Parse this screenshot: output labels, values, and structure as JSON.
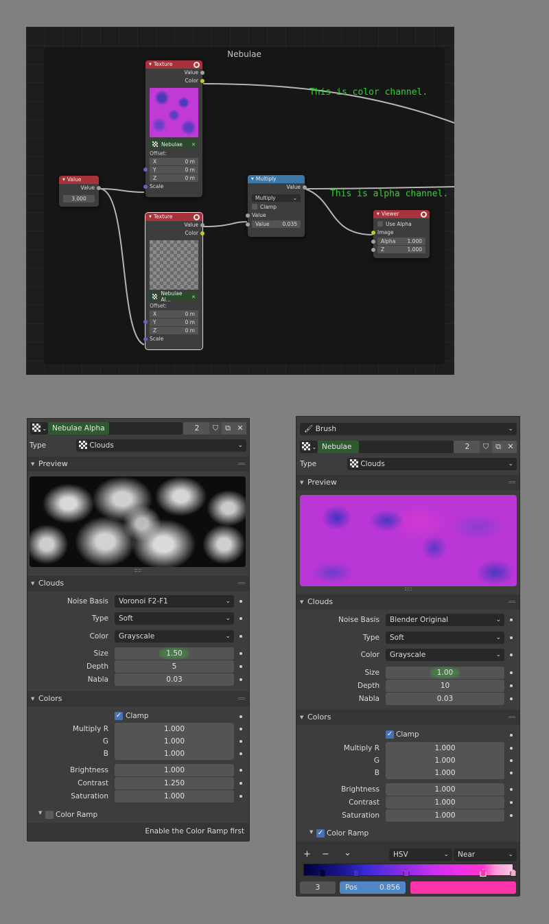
{
  "node_editor": {
    "frame_title": "Nebulae",
    "annotations": {
      "color_note": "This is color channel.",
      "alpha_note": "This is alpha channel."
    },
    "nodes": {
      "texture_top": {
        "title": "Texture",
        "outputs": [
          "Value",
          "Color"
        ],
        "texture_name": "Nebulae",
        "offset_label": "Offset:",
        "offset": [
          {
            "axis": "X",
            "value": "0 m"
          },
          {
            "axis": "Y",
            "value": "0 m"
          },
          {
            "axis": "Z",
            "value": "0 m"
          }
        ],
        "scale_label": "Scale"
      },
      "texture_bottom": {
        "title": "Texture",
        "outputs": [
          "Value",
          "Color"
        ],
        "texture_name": "Nebulae Al...",
        "offset_label": "Offset:",
        "offset": [
          {
            "axis": "X",
            "value": "0 m"
          },
          {
            "axis": "Y",
            "value": "0 m"
          },
          {
            "axis": "Z",
            "value": "0 m"
          }
        ],
        "scale_label": "Scale"
      },
      "value": {
        "title": "Value",
        "output": "Value",
        "value": "3.000"
      },
      "multiply": {
        "title": "Multiply",
        "output": "Value",
        "operation": "Multiply",
        "clamp_label": "Clamp",
        "input_label": "Value",
        "field_label": "Value",
        "field_value": "0.035"
      },
      "viewer": {
        "title": "Viewer",
        "use_alpha_label": "Use Alpha",
        "image_label": "Image",
        "alpha_label": "Alpha",
        "alpha_value": "1.000",
        "z_label": "Z",
        "z_value": "1.000"
      }
    }
  },
  "panel_left": {
    "texture_name": "Nebulae Alpha",
    "users": "2",
    "type_label": "Type",
    "type_value": "Clouds",
    "preview_label": "Preview",
    "clouds": {
      "header": "Clouds",
      "noise_basis_label": "Noise Basis",
      "noise_basis": "Voronoi F2-F1",
      "type_label": "Type",
      "type": "Soft",
      "color_label": "Color",
      "color": "Grayscale",
      "size_label": "Size",
      "size": "1.50",
      "depth_label": "Depth",
      "depth": "5",
      "nabla_label": "Nabla",
      "nabla": "0.03"
    },
    "colors": {
      "header": "Colors",
      "clamp_label": "Clamp",
      "clamp": true,
      "multiply_r_label": "Multiply R",
      "multiply_r": "1.000",
      "g_label": "G",
      "g": "1.000",
      "b_label": "B",
      "b": "1.000",
      "brightness_label": "Brightness",
      "brightness": "1.000",
      "contrast_label": "Contrast",
      "contrast": "1.250",
      "saturation_label": "Saturation",
      "saturation": "1.000",
      "color_ramp_label": "Color Ramp",
      "color_ramp_enabled": false,
      "color_ramp_hint": "Enable the Color Ramp first"
    }
  },
  "panel_right": {
    "context_label": "Brush",
    "texture_name": "Nebulae",
    "users": "2",
    "type_label": "Type",
    "type_value": "Clouds",
    "preview_label": "Preview",
    "clouds": {
      "header": "Clouds",
      "noise_basis_label": "Noise Basis",
      "noise_basis": "Blender Original",
      "type_label": "Type",
      "type": "Soft",
      "color_label": "Color",
      "color": "Grayscale",
      "size_label": "Size",
      "size": "1.00",
      "depth_label": "Depth",
      "depth": "10",
      "nabla_label": "Nabla",
      "nabla": "0.03"
    },
    "colors": {
      "header": "Colors",
      "clamp_label": "Clamp",
      "clamp": true,
      "multiply_r_label": "Multiply R",
      "multiply_r": "1.000",
      "g_label": "G",
      "g": "1.000",
      "b_label": "B",
      "b": "1.000",
      "brightness_label": "Brightness",
      "brightness": "1.000",
      "contrast_label": "Contrast",
      "contrast": "1.000",
      "saturation_label": "Saturation",
      "saturation": "1.000",
      "color_ramp_label": "Color Ramp",
      "color_ramp_enabled": true
    },
    "color_ramp": {
      "add_label": "+",
      "remove_label": "−",
      "menu_label": "⌄",
      "color_mode": "HSV",
      "interpolation": "Near",
      "active_index": "3",
      "pos_label": "Pos",
      "pos_value": "0.856",
      "active_color": "#ff33aa",
      "stops": [
        {
          "pos": 0.09,
          "color": "#000040"
        },
        {
          "pos": 0.25,
          "color": "#3a2ad8"
        },
        {
          "pos": 0.49,
          "color": "#9a2ee0"
        },
        {
          "pos": 0.856,
          "color": "#ff33aa"
        },
        {
          "pos": 1.0,
          "color": "#f0b0d0"
        }
      ]
    }
  },
  "colors": {
    "node_red": "#a8323c",
    "node_blue": "#3b78a8",
    "note_green": "#2fd42f",
    "checkbox_blue": "#4772b3",
    "pos_blue": "#4f86c6"
  }
}
